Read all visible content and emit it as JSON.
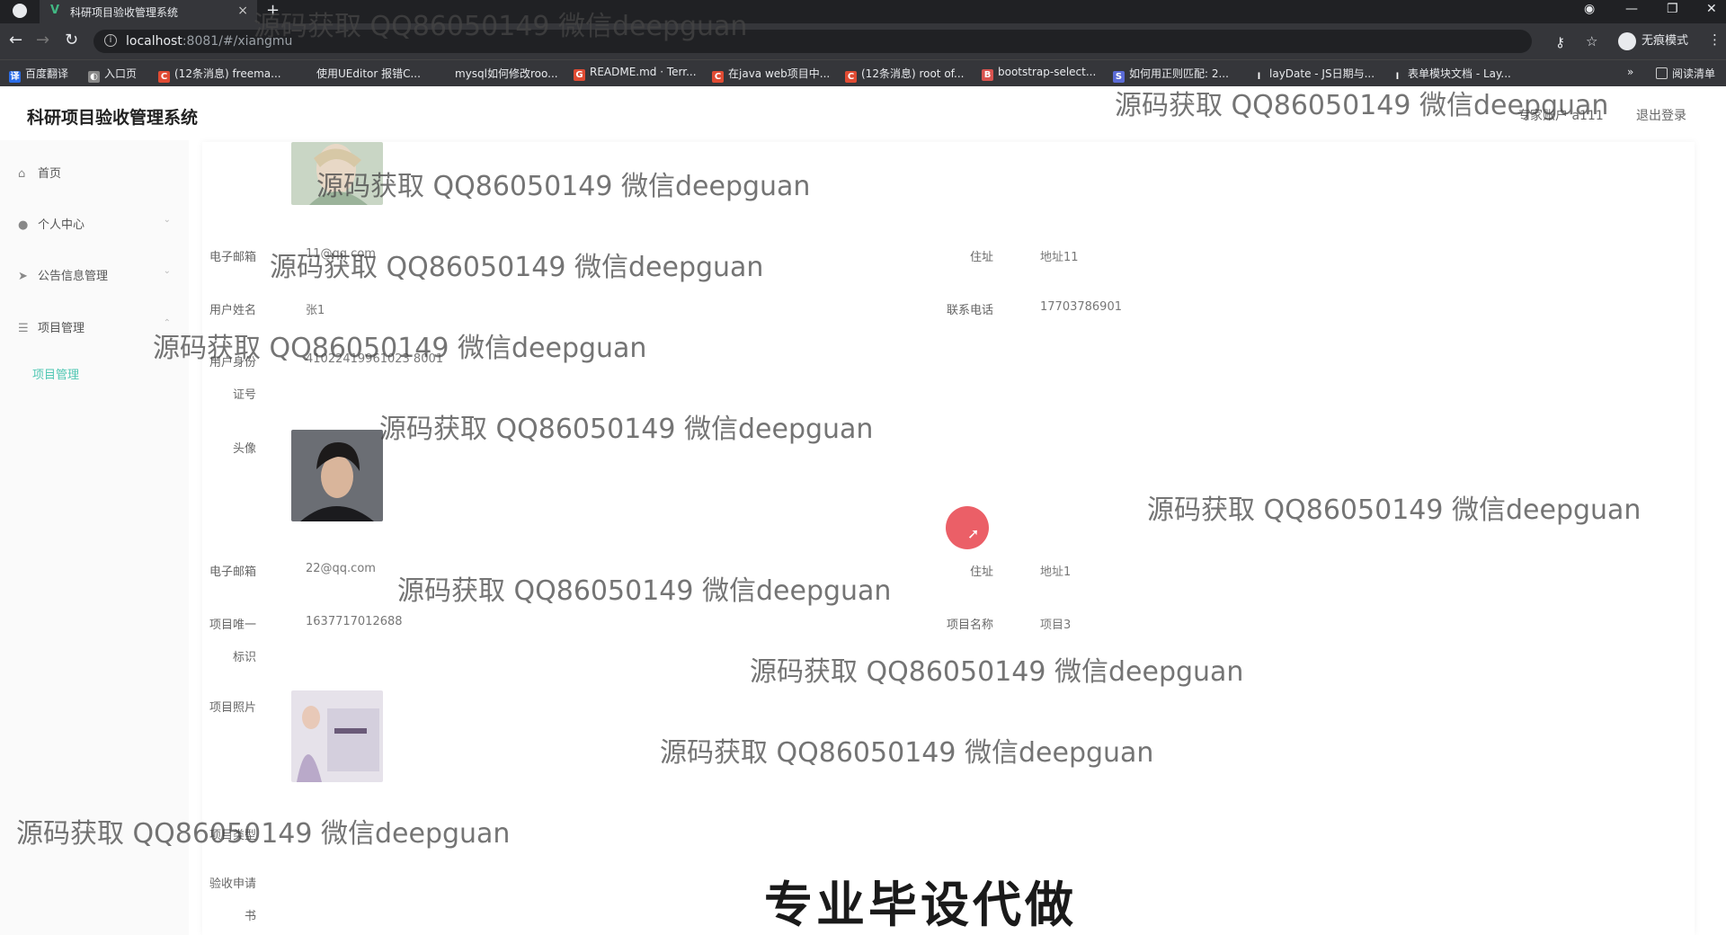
{
  "browser": {
    "tab_title": "科研项目验收管理系统",
    "url_host": "localhost",
    "url_rest": ":8081/#/xiangmu",
    "incognito_label": "无痕模式",
    "reading_list": "阅读清单",
    "bookmarks": [
      {
        "label": "百度翻译",
        "color": "#2b6de8",
        "glyph": "译"
      },
      {
        "label": "入口页",
        "color": "#888888",
        "glyph": "◐"
      },
      {
        "label": "(12条消息) freema...",
        "color": "#e04b33",
        "glyph": "C"
      },
      {
        "label": "使用UEditor 报错C...",
        "color": "#35363a",
        "glyph": ""
      },
      {
        "label": "mysql如何修改roo...",
        "color": "#35363a",
        "glyph": ""
      },
      {
        "label": "README.md · Terr...",
        "color": "#e04b33",
        "glyph": "G"
      },
      {
        "label": "在java web项目中...",
        "color": "#e04b33",
        "glyph": "C"
      },
      {
        "label": "(12条消息) root of...",
        "color": "#e04b33",
        "glyph": "C"
      },
      {
        "label": "bootstrap-select...",
        "color": "#d9534f",
        "glyph": "B"
      },
      {
        "label": "如何用正则匹配: 2...",
        "color": "#5b6bd6",
        "glyph": "S"
      },
      {
        "label": "layDate - JS日期与...",
        "color": "#35363a",
        "glyph": "l"
      },
      {
        "label": "表单模块文档 - Lay...",
        "color": "#35363a",
        "glyph": "l"
      }
    ]
  },
  "app": {
    "title": "科研项目验收管理系统",
    "account": "专家账户 a111",
    "logout": "退出登录"
  },
  "sidebar": {
    "items": [
      {
        "label": "首页",
        "icon": "home-icon",
        "glyph": "⌂"
      },
      {
        "label": "个人中心",
        "icon": "user-icon",
        "glyph": "●"
      },
      {
        "label": "公告信息管理",
        "icon": "send-icon",
        "glyph": "➤"
      },
      {
        "label": "项目管理",
        "icon": "list-icon",
        "glyph": "☰"
      }
    ],
    "active_sub": "项目管理"
  },
  "detail": {
    "email_label_1": "电子邮箱",
    "email_value_1": "11@qq.com",
    "address_label_1": "住址",
    "address_value_1": "地址11",
    "name_label": "用户姓名",
    "name_value": "张1",
    "phone_label": "联系电话",
    "phone_value": "17703786901",
    "id_label_a": "用户身份",
    "id_label_b": "证号",
    "id_value": "41022419961023 8001",
    "avatar_label": "头像",
    "email_label_2": "电子邮箱",
    "email_value_2": "22@qq.com",
    "address_label_2": "住址",
    "address_value_2": "地址1",
    "proj_id_label_a": "项目唯一",
    "proj_id_label_b": "标识",
    "proj_id_value": "1637717012688",
    "proj_name_label": "项目名称",
    "proj_name_value": "项目3",
    "proj_photo_label": "项目照片",
    "proj_type_label": "项目类型",
    "accept_label_a": "验收申请",
    "accept_label_b": "书"
  },
  "overlay": {
    "watermark": "源码获取 QQ86050149 微信deepguan",
    "banner": "专业毕设代做"
  },
  "colors": {
    "accent": "#4fc7b3",
    "chrome_dark": "#202124",
    "chrome_mid": "#35363a"
  }
}
